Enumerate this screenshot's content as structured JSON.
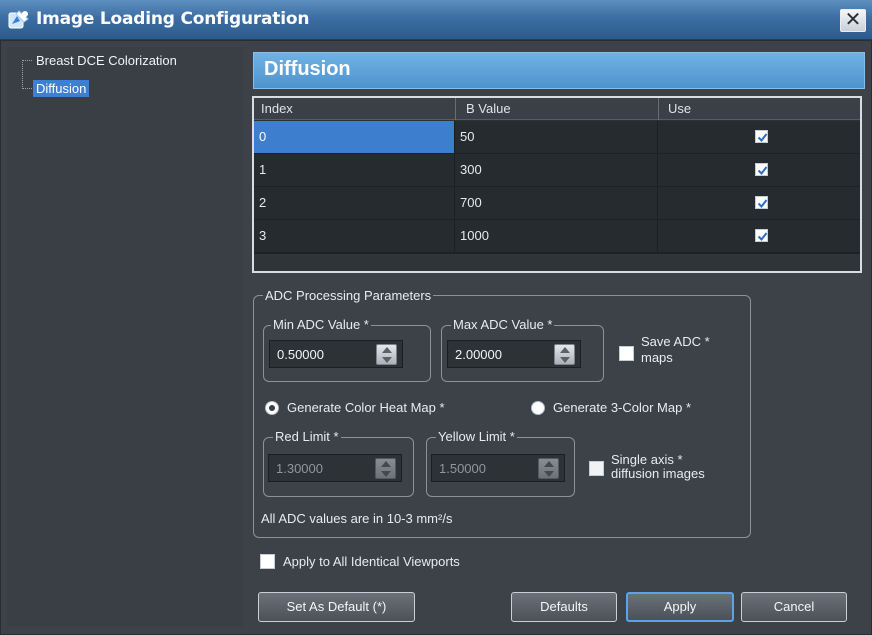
{
  "window": {
    "title": "Image Loading Configuration",
    "close_glyph": "✕"
  },
  "nav": {
    "items": [
      {
        "label": "Breast DCE Colorization",
        "selected": false
      },
      {
        "label": "Diffusion",
        "selected": true
      }
    ]
  },
  "section": {
    "title": "Diffusion"
  },
  "table": {
    "columns": [
      "Index",
      "B Value",
      "Use"
    ],
    "rows": [
      {
        "index": "0",
        "b_value": "50",
        "use": true
      },
      {
        "index": "1",
        "b_value": "300",
        "use": true
      },
      {
        "index": "2",
        "b_value": "700",
        "use": true
      },
      {
        "index": "3",
        "b_value": "1000",
        "use": true
      }
    ]
  },
  "adc": {
    "group_title": "ADC Processing Parameters",
    "min_label": "Min ADC Value *",
    "min_value": "0.50000",
    "max_label": "Max ADC Value *",
    "max_value": "2.00000",
    "save_maps_label_1": "Save ADC *",
    "save_maps_label_2": "maps",
    "radio_heat": "Generate Color Heat Map *",
    "radio_3color": "Generate 3-Color Map *",
    "red_label": "Red Limit *",
    "red_value": "1.30000",
    "yellow_label": "Yellow Limit *",
    "yellow_value": "1.50000",
    "single_axis_label_1": "Single axis *",
    "single_axis_label_2": "diffusion images",
    "units_note": "All ADC values are in 10-3 mm²/s"
  },
  "apply_all_label": "Apply to All Identical Viewports",
  "buttons": {
    "set_default": "Set As Default (*)",
    "defaults": "Defaults",
    "apply": "Apply",
    "cancel": "Cancel"
  },
  "colors": {
    "title_bar": "#3c6ea3",
    "header": "#5ca2d8",
    "selection": "#3e7ecf",
    "background": "#3d4248"
  },
  "icons": {
    "title": "app-logo-icon",
    "close": "close-icon",
    "checkbox": "checkmark-icon"
  }
}
